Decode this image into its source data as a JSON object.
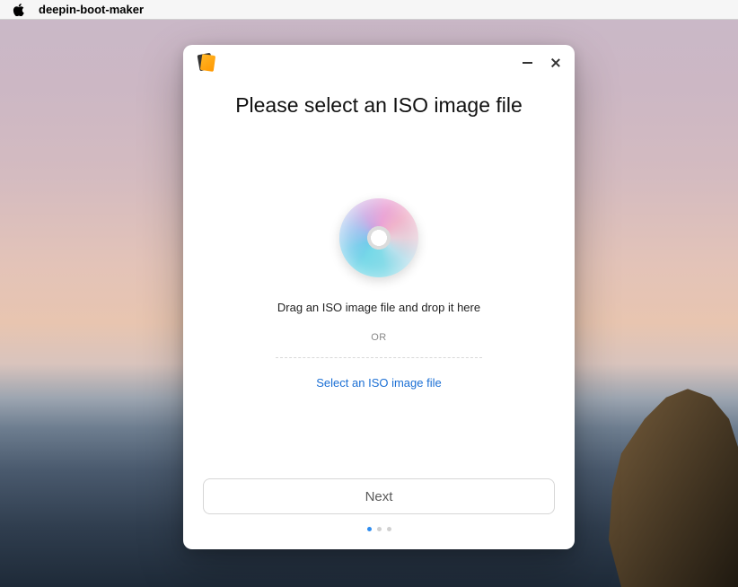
{
  "menubar": {
    "app_title": "deepin-boot-maker"
  },
  "window": {
    "heading": "Please select an ISO image file",
    "drop_text": "Drag an ISO image file and drop it here",
    "or_text": "OR",
    "select_link": "Select an ISO image file",
    "next_button": "Next",
    "pager": {
      "total": 3,
      "active_index": 0
    }
  }
}
